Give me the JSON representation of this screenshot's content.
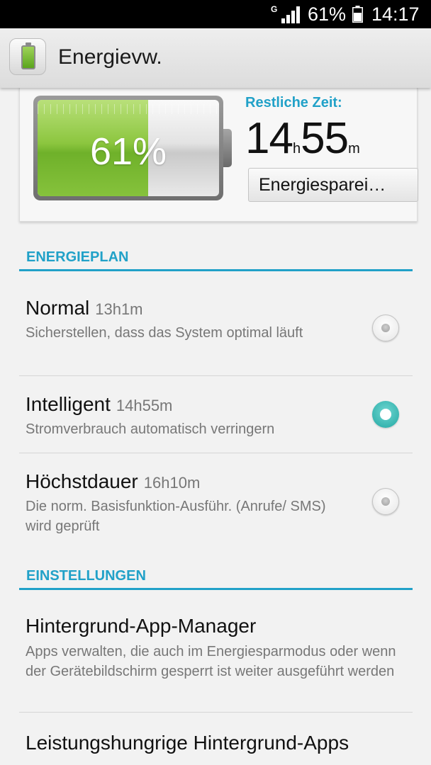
{
  "status_bar": {
    "network": "G",
    "battery_percent": "61%",
    "time": "14:17"
  },
  "action_bar": {
    "title": "Energievw.",
    "icon": "battery-app-icon"
  },
  "battery_card": {
    "percent_label": "61%",
    "charge_fraction": 0.61,
    "remaining_label": "Restliche Zeit:",
    "hours": "14",
    "hours_unit": "h",
    "minutes": "55",
    "minutes_unit": "m",
    "saver_button": "Energiesparei…"
  },
  "energy_plan": {
    "header": "ENERGIEPLAN",
    "items": [
      {
        "title": "Normal",
        "duration": "13h1m",
        "description": "Sicherstellen, dass das System optimal läuft",
        "selected": false
      },
      {
        "title": "Intelligent",
        "duration": "14h55m",
        "description": "Stromverbrauch automatisch verringern",
        "selected": true
      },
      {
        "title": "Höchstdauer",
        "duration": "16h10m",
        "description": "Die norm. Basisfunktion-Ausführ. (Anrufe/ SMS) wird geprüft",
        "selected": false
      }
    ]
  },
  "settings": {
    "header": "EINSTELLUNGEN",
    "items": [
      {
        "title": "Hintergrund-App-Manager",
        "description": "Apps verwalten, die auch im Energiesparmodus oder wenn der Gerätebildschirm gesperrt ist weiter ausgeführt werden"
      },
      {
        "title": "Leistungshungrige Hintergrund-Apps",
        "description": ""
      }
    ]
  },
  "colors": {
    "accent": "#21a1c8",
    "radio_checked": "#22a8a3",
    "battery_green": "#8cc63f"
  }
}
